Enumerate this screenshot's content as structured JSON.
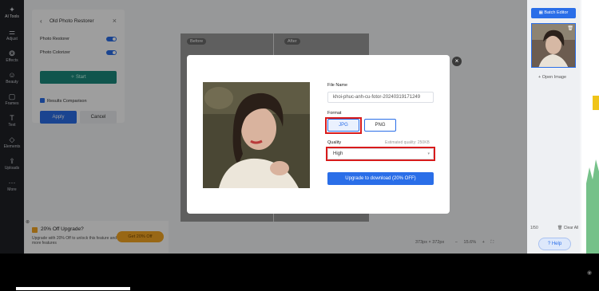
{
  "rail": {
    "items": [
      {
        "label": "AI Tools",
        "icon": "ai-icon"
      },
      {
        "label": "Adjust",
        "icon": "sliders-icon"
      },
      {
        "label": "Effects",
        "icon": "effects-icon"
      },
      {
        "label": "Beauty",
        "icon": "beauty-icon"
      },
      {
        "label": "Frames",
        "icon": "frame-icon"
      },
      {
        "label": "Text",
        "icon": "text-icon"
      },
      {
        "label": "Elements",
        "icon": "elements-icon"
      },
      {
        "label": "Uploads",
        "icon": "upload-icon"
      },
      {
        "label": "More",
        "icon": "more-icon"
      }
    ]
  },
  "panel": {
    "title": "Old Photo Restorer",
    "photo_restorer": "Photo Restorer",
    "photo_colorizer": "Photo Colorizer",
    "start": "Start",
    "results_comparison": "Results Comparison",
    "apply": "Apply",
    "cancel": "Cancel"
  },
  "canvas": {
    "before": "Before",
    "after": "After"
  },
  "promo": {
    "title": "20% Off Upgrade?",
    "text": "Upgrade with 20% Off to unlock this feature and more features",
    "button": "Get 20% Off"
  },
  "statusbar": {
    "size": "373px × 372px",
    "zoom": "15.6%"
  },
  "right": {
    "batch_editor": "Batch Editor",
    "open_image": "+ Open Image",
    "count": "1/50",
    "clear_all": "Clear All"
  },
  "help": "Help",
  "modal": {
    "file_name_label": "File Name",
    "file_name_value": "khoi-phuc-anh-cu-fotor-20240319171249",
    "format_label": "Format",
    "format_jpg": "JPG",
    "format_png": "PNG",
    "quality_label": "Quality",
    "estimated": "Estimated quality: 250KB",
    "quality_value": "High",
    "download": "Upgrade to download (20% OFF)",
    "close": "×"
  },
  "colors": {
    "accent": "#2a6ee8",
    "highlight": "#d81b1b",
    "promo": "#f5a623"
  }
}
